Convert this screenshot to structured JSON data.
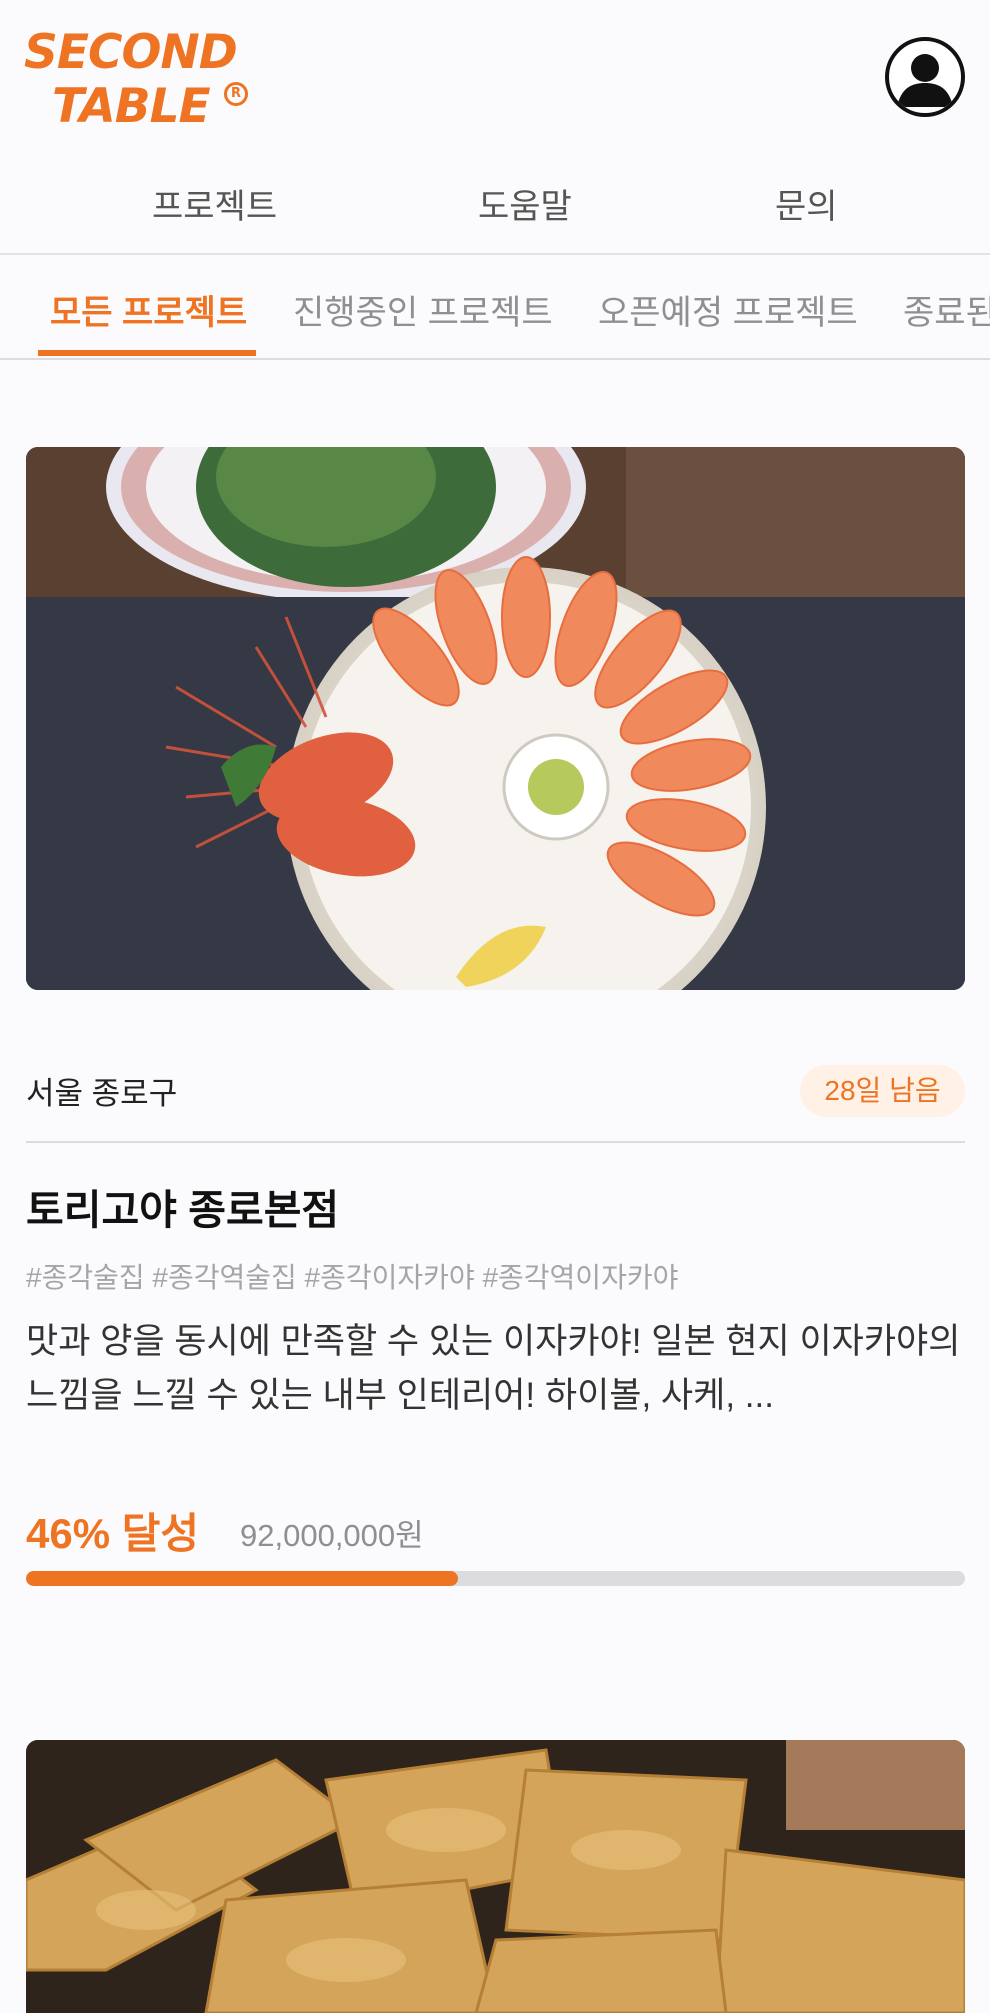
{
  "brand": {
    "logo_line1": "SECOND",
    "logo_line2": "TABLE",
    "logo_mark": "R",
    "accent": "#ee7322"
  },
  "header": {
    "profile_icon": "user-avatar-icon"
  },
  "topnav": {
    "items": [
      "프로젝트",
      "도움말",
      "문의"
    ]
  },
  "tabs": {
    "items": [
      "모든 프로젝트",
      "진행중인 프로젝트",
      "오픈예정 프로젝트",
      "종료된"
    ],
    "active_index": 0
  },
  "projects": [
    {
      "location": "서울 종로구",
      "days_left": "28일 남음",
      "title": "토리고야 종로본점",
      "tags": "#종각술집 #종각역술집 #종각이자카야 #종각역이자카야",
      "description": "맛과 양을 동시에 만족할 수 있는 이자카야! 일본 현지 이자카야의 느낌을 느낄 수 있는 내부 인테리어! 하이볼, 사케, ...",
      "percent_label": "46% 달성",
      "amount": "92,000,000원",
      "progress": 0.46
    }
  ]
}
